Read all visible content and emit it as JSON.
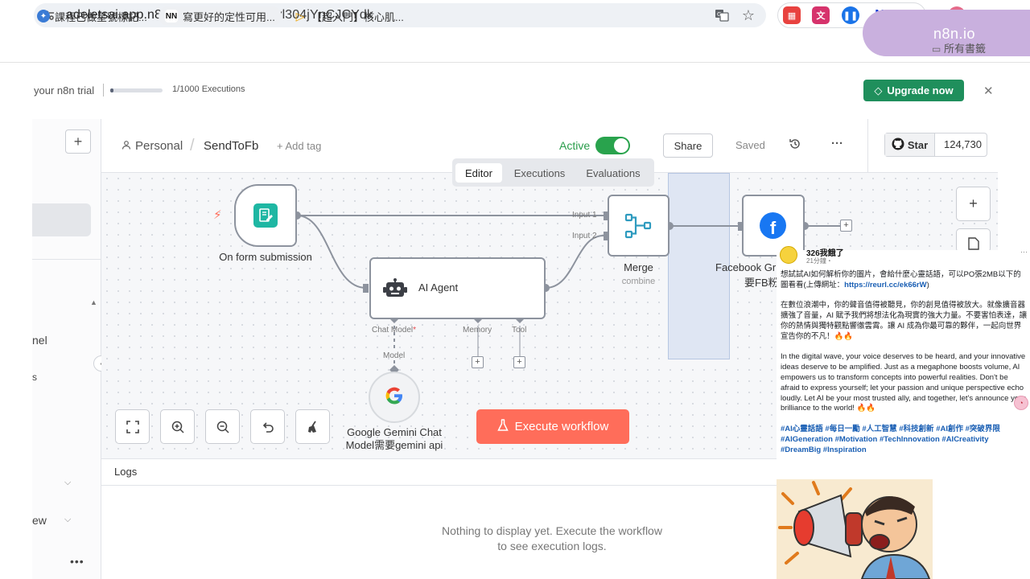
{
  "browser": {
    "url_host": "adeletsai.app.n8n.cloud",
    "url_path": "/workflow/ucyl304jYnCJCYdk",
    "bookmarks": [
      {
        "label": "課程已做星號標記..."
      },
      {
        "label": "寫更好的定性可用...",
        "icon_text": "NN"
      },
      {
        "label": "【超入門】核心肌..."
      }
    ],
    "all_bookmarks": "所有書籤",
    "overlay_tag": "n8n.io"
  },
  "trial": {
    "text": "your n8n trial",
    "executions": "1/1000 Executions",
    "progress_fraction": 0.001,
    "upgrade_label": "Upgrade now"
  },
  "sidebar": {
    "partial_text_1": "nel",
    "partial_text_2": "s",
    "partial_text_3": "ew"
  },
  "header": {
    "breadcrumb_project": "Personal",
    "workflow_name": "SendToFb",
    "add_tag": "+ Add tag",
    "active_label": "Active",
    "active": true,
    "share_label": "Share",
    "saved_label": "Saved",
    "github_star": "Star",
    "github_count": "124,730"
  },
  "tabs": [
    "Editor",
    "Executions",
    "Evaluations"
  ],
  "nodes": {
    "form": {
      "label": "On form submission"
    },
    "agent": {
      "label": "AI Agent",
      "ports": [
        "Chat Model",
        "Memory",
        "Tool"
      ],
      "required_mark": "*"
    },
    "merge": {
      "label": "Merge",
      "sublabel": "combine",
      "inputs": [
        "Input 1",
        "Input 2"
      ]
    },
    "facebook": {
      "label": "Facebook Gr",
      "label_line2": "要FB粉"
    },
    "gemini": {
      "label": "Google Gemini Chat Model需要gemini api",
      "port_label": "Model"
    }
  },
  "canvas": {
    "execute_label": "Execute workflow"
  },
  "logs": {
    "title": "Logs",
    "empty_message": "Nothing to display yet. Execute the workflow to see execution logs."
  },
  "post": {
    "author": "326我餓了",
    "time": "21分鐘・",
    "intro": "想試試AI如何解析你的圖片，會給什麼心靈話語，可以PO張2MB以下的圖看看(上傳網址：",
    "link": "https://reurl.cc/ek66rW",
    "intro_end": ")",
    "zh_lines": "在數位浪潮中，你的聲音值得被聽見，你的創見值得被放大。就像擴音器擴強了音量，AI 賦予我們將想法化為現實的強大力量。不要害怕表達，讓你的熱情與獨特觀點響徹雲霄。讓 AI 成為你最可靠的夥伴，一起向世界宣告你的不凡！🔥🔥",
    "en_lines": "In the digital wave, your voice deserves to be heard, and your innovative ideas deserve to be amplified. Just as a megaphone boosts volume, AI empowers us to transform concepts into powerful realities. Don't be afraid to express yourself; let your passion and unique perspective echo loudly. Let AI be your most trusted ally, and together, let's announce your brilliance to the world! 🔥🔥",
    "tags": "#AI心靈話語 #每日一勵 #人工智慧 #科技創新 #AI創作 #突破界限 #AIGeneration #Motivation #TechInnovation #AICreativity #DreamBig #Inspiration"
  }
}
